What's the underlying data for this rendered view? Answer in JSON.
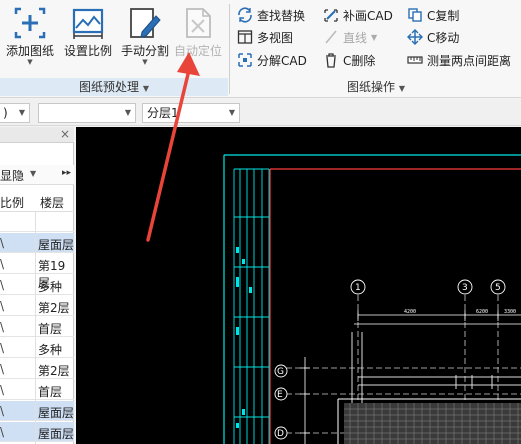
{
  "ribbon": {
    "preprocess": {
      "group_label": "图纸预处理",
      "buttons": [
        {
          "label": "添加图纸"
        },
        {
          "label": "设置比例"
        },
        {
          "label": "手动分割"
        },
        {
          "label": "自动定位"
        }
      ]
    },
    "operations": {
      "group_label": "图纸操作",
      "col1": [
        "查找替换",
        "多视图",
        "分解CAD"
      ],
      "col2": [
        "补画CAD",
        "直线",
        "C删除"
      ],
      "col3": [
        "C复制",
        "C移动",
        "测量两点间距离"
      ]
    }
  },
  "toolbar": {
    "combo1_value": ")",
    "combo2_value": "",
    "combo3_value": "分层1"
  },
  "layer_panel": {
    "close_glyph": "×",
    "filter_value": "显隐",
    "header_scale": "比例",
    "header_floor": "楼层",
    "rows": [
      {
        "scale": "",
        "floor": ""
      },
      {
        "scale": "\\",
        "floor": "屋面层",
        "selected": true
      },
      {
        "scale": "\\",
        "floor": "第19层"
      },
      {
        "scale": "\\",
        "floor": "多种"
      },
      {
        "scale": "\\",
        "floor": "第2层"
      },
      {
        "scale": "\\",
        "floor": "首层"
      },
      {
        "scale": "\\",
        "floor": "多种"
      },
      {
        "scale": "\\",
        "floor": "第2层"
      },
      {
        "scale": "\\",
        "floor": "首层"
      },
      {
        "scale": "\\",
        "floor": "屋面层",
        "selected": true
      },
      {
        "scale": "\\",
        "floor": "屋面层",
        "selected": true
      }
    ]
  },
  "canvas": {
    "axis_bubbles": [
      "1",
      "3",
      "5",
      "G",
      "E",
      "D"
    ],
    "dim_labels": [
      "4200",
      "6200",
      "3300"
    ]
  },
  "colors": {
    "cad_background": "#000000",
    "cyan_frame": "#00e5e5",
    "red_border": "#ff3c3c",
    "annotation_arrow": "#e8443a",
    "selected_row": "#cfe0f4"
  }
}
